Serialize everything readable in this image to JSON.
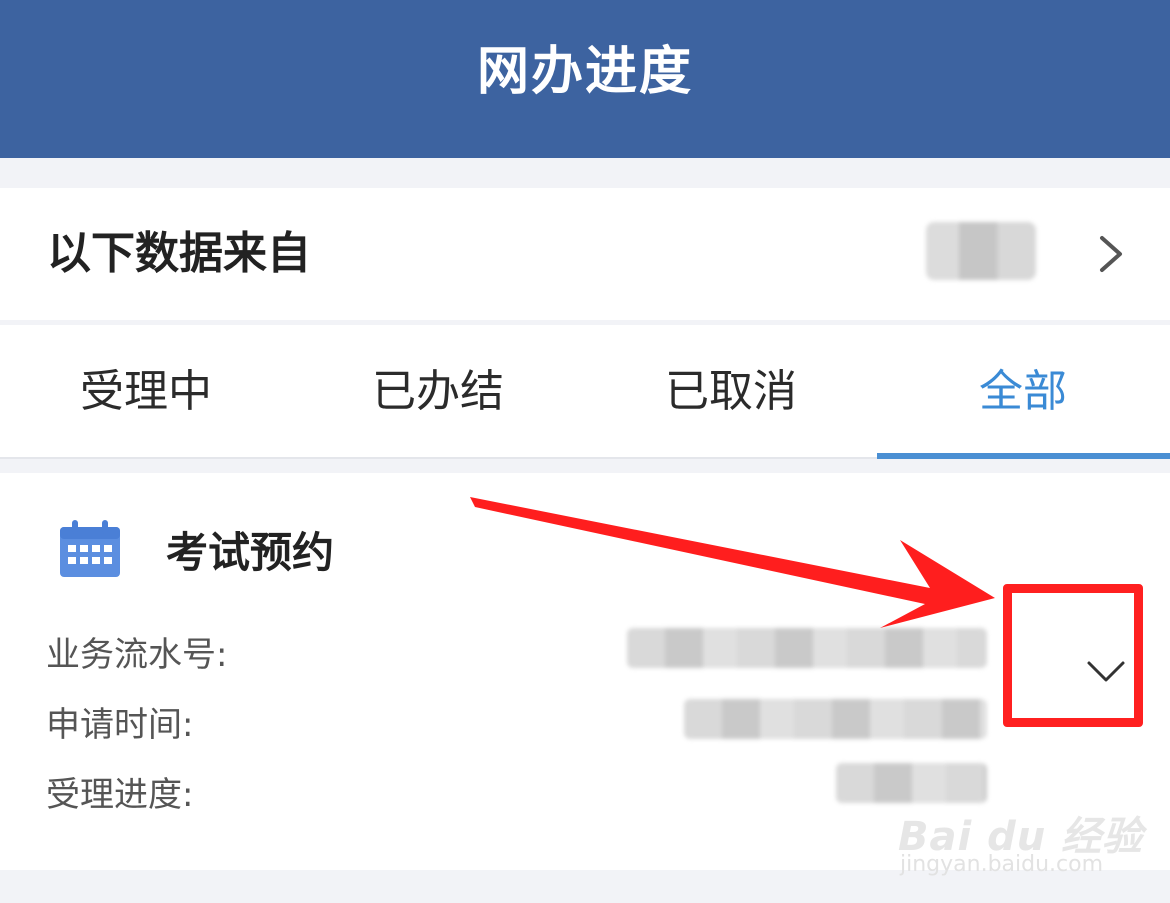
{
  "header": {
    "title": "网办进度"
  },
  "source": {
    "label": "以下数据来自"
  },
  "tabs": [
    {
      "label": "受理中",
      "active": false
    },
    {
      "label": "已办结",
      "active": false
    },
    {
      "label": "已取消",
      "active": false
    },
    {
      "label": "全部",
      "active": true
    }
  ],
  "card": {
    "title": "考试预约",
    "icon": "calendar-icon",
    "fields": [
      {
        "label": "业务流水号:"
      },
      {
        "label": "申请时间:"
      },
      {
        "label": "受理进度:"
      }
    ]
  },
  "colors": {
    "header_bg": "#3d63a0",
    "active_tab": "#3a8ad5",
    "annotation": "#ff2020"
  },
  "watermark": {
    "logo": "Bai du 经验",
    "url": "jingyan.baidu.com"
  }
}
